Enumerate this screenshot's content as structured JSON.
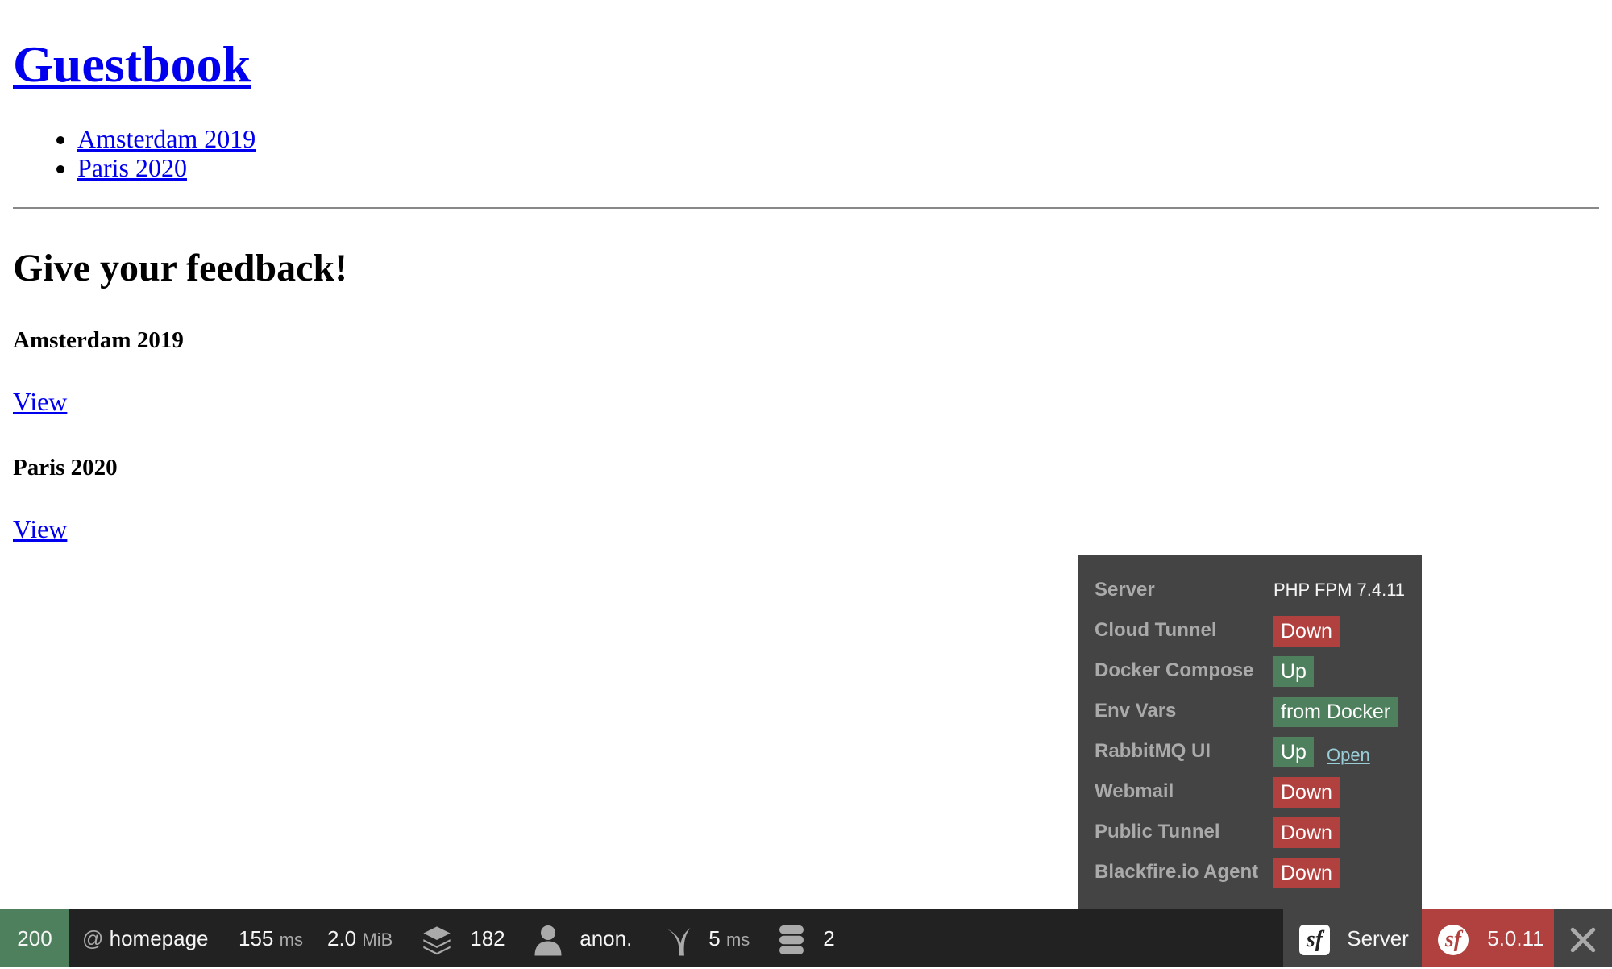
{
  "site": {
    "title": "Guestbook",
    "nav": [
      "Amsterdam 2019",
      "Paris 2020"
    ]
  },
  "main": {
    "heading": "Give your feedback!",
    "conferences": [
      {
        "name": "Amsterdam 2019",
        "link": "View"
      },
      {
        "name": "Paris 2020",
        "link": "View"
      }
    ]
  },
  "server_panel": {
    "rows": [
      {
        "label": "Server",
        "value": "PHP FPM 7.4.11",
        "kind": "text"
      },
      {
        "label": "Cloud Tunnel",
        "value": "Down",
        "kind": "down"
      },
      {
        "label": "Docker Compose",
        "value": "Up",
        "kind": "up"
      },
      {
        "label": "Env Vars",
        "value": "from Docker",
        "kind": "up"
      },
      {
        "label": "RabbitMQ UI",
        "value": "Up",
        "kind": "up",
        "link": "Open"
      },
      {
        "label": "Webmail",
        "value": "Down",
        "kind": "down"
      },
      {
        "label": "Public Tunnel",
        "value": "Down",
        "kind": "down"
      },
      {
        "label": "Blackfire.io Agent",
        "value": "Down",
        "kind": "down"
      }
    ]
  },
  "toolbar": {
    "status": "200",
    "route_at": "@",
    "route": "homepage",
    "time_value": "155",
    "time_unit": "ms",
    "memory_value": "2.0",
    "memory_unit": "MiB",
    "forms_count": "182",
    "user": "anon.",
    "twig_value": "5",
    "twig_unit": "ms",
    "db_count": "2",
    "server_label": "Server",
    "symfony_version": "5.0.11",
    "icons": {
      "forms": "layers-icon",
      "user": "user-icon",
      "twig": "twig-icon",
      "db": "database-icon",
      "close": "close-icon"
    },
    "colors": {
      "green": "#4f805d",
      "red": "#b0413e",
      "dark": "#222222",
      "gray": "#444444"
    }
  }
}
